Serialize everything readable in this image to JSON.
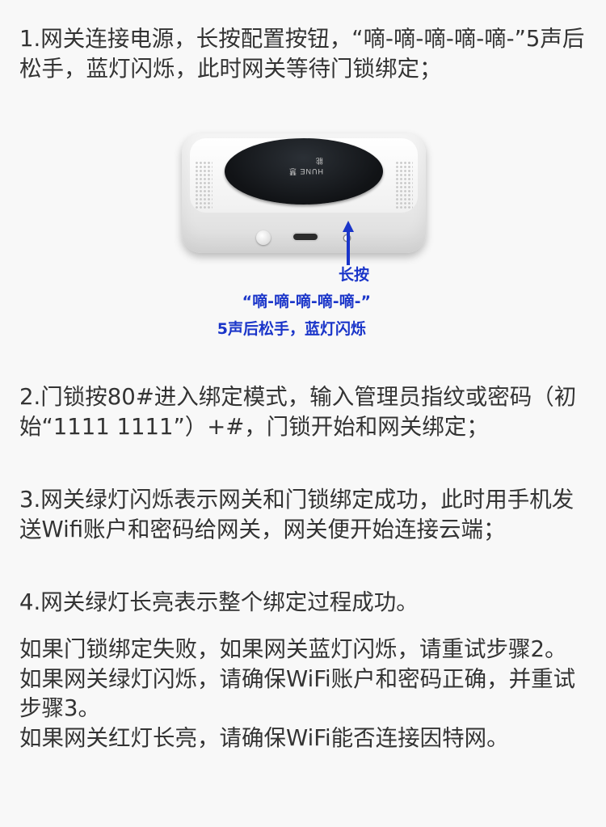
{
  "step1": "1.网关连接电源，长按配置按钮，“嘀-嘀-嘀-嘀-嘀-”5声后松手，蓝灯闪烁，此时网关等待门锁绑定；",
  "image": {
    "logo_text": "HUNE 慧能",
    "callout_line1": "长按",
    "callout_line2": "“嘀-嘀-嘀-嘀-嘀-”",
    "callout_line3": "5声后松手，蓝灯闪烁",
    "callout_color": "#1a35c9"
  },
  "step2": "2.门锁按80#进入绑定模式，输入管理员指纹或密码（初始“1111 1111”）+#，门锁开始和网关绑定；",
  "step3": "3.网关绿灯闪烁表示网关和门锁绑定成功，此时用手机发送Wifi账户和密码给网关，网关便开始连接云端；",
  "step4": "4.网关绿灯长亮表示整个绑定过程成功。",
  "tips": [
    "如果门锁绑定失败，如果网关蓝灯闪烁，请重试步骤2。",
    "如果网关绿灯闪烁，请确保WiFi账户和密码正确，并重试步骤3。",
    "如果网关红灯长亮，请确保WiFi能否连接因特网。"
  ]
}
